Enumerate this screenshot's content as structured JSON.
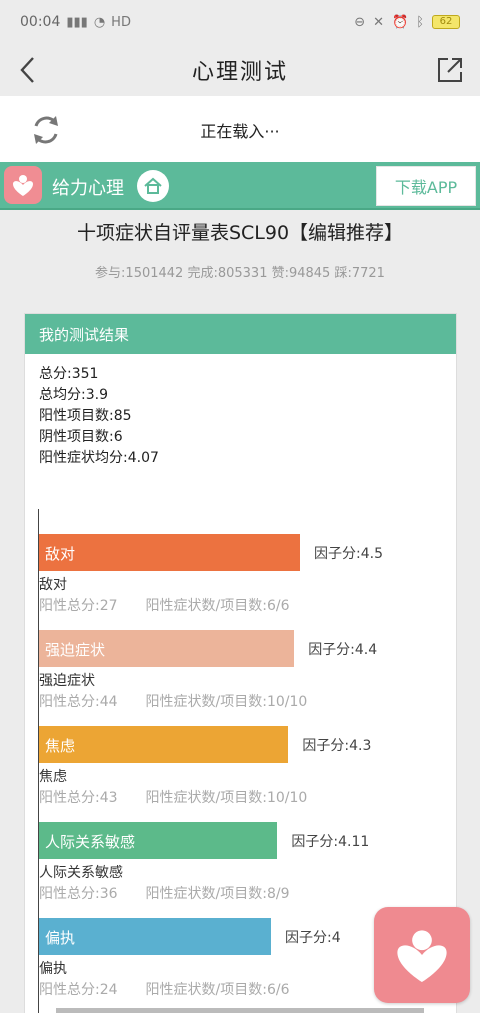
{
  "status": {
    "time": "00:04",
    "network": "HD",
    "battery": "62"
  },
  "header": {
    "title": "心理测试"
  },
  "loading": {
    "text": "正在载入···"
  },
  "brand": {
    "name": "给力心理",
    "download_label": "下载APP"
  },
  "test": {
    "title": "十项症状自评量表SCL90【编辑推荐】",
    "stats": "参与:1501442 完成:805331 赞:94845 踩:7721"
  },
  "result": {
    "header": "我的测试结果",
    "summary": [
      "总分:351",
      "总均分:3.9",
      "阳性项目数:85",
      "阴性项目数:6",
      "阳性症状均分:4.07"
    ],
    "factors": [
      {
        "name": "敌对",
        "score_text": "因子分:4.5",
        "score": 4.5,
        "positive_total": "阳性总分:27",
        "ratio": "阳性症状数/项目数:6/6",
        "color": "#ec7240"
      },
      {
        "name": "强迫症状",
        "score_text": "因子分:4.4",
        "score": 4.4,
        "positive_total": "阳性总分:44",
        "ratio": "阳性症状数/项目数:10/10",
        "color": "#ecb49a"
      },
      {
        "name": "焦虑",
        "score_text": "因子分:4.3",
        "score": 4.3,
        "positive_total": "阳性总分:43",
        "ratio": "阳性症状数/项目数:10/10",
        "color": "#eca534"
      },
      {
        "name": "人际关系敏感",
        "score_text": "因子分:4.11",
        "score": 4.11,
        "positive_total": "阳性总分:36",
        "ratio": "阳性症状数/项目数:8/9",
        "color": "#5cba8a"
      },
      {
        "name": "偏执",
        "score_text": "因子分:4",
        "score": 4,
        "positive_total": "阳性总分:24",
        "ratio": "阳性症状数/项目数:6/6",
        "color": "#5ab0d0"
      }
    ]
  }
}
